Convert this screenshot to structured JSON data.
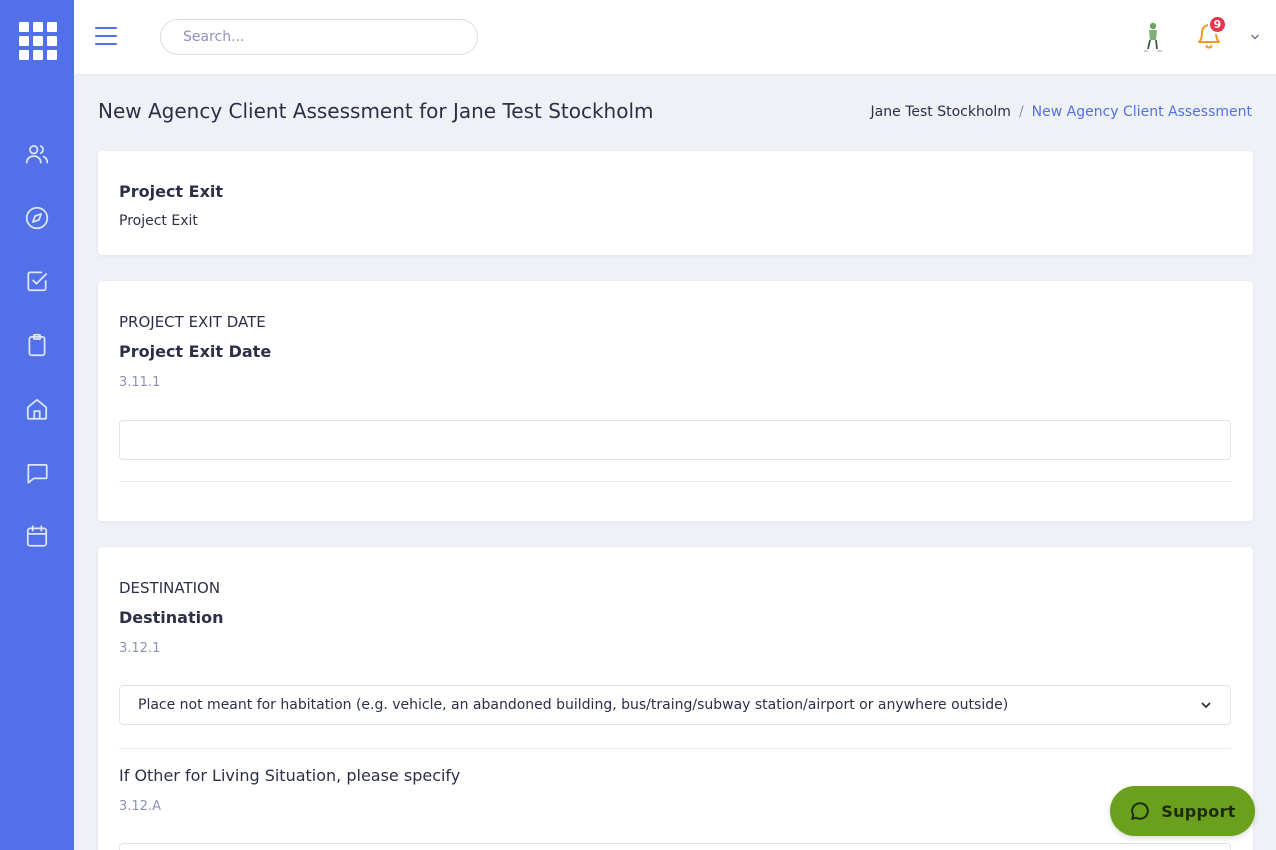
{
  "colors": {
    "primary": "#5271e8",
    "badge": "#e8344a",
    "support": "#6aa01b"
  },
  "topbar": {
    "search_placeholder": "Search...",
    "notification_count": "9"
  },
  "sidebar": {
    "items": [
      {
        "icon": "users-icon"
      },
      {
        "icon": "compass-icon"
      },
      {
        "icon": "checkbox-icon"
      },
      {
        "icon": "clipboard-icon"
      },
      {
        "icon": "home-icon"
      },
      {
        "icon": "message-icon"
      },
      {
        "icon": "calendar-icon"
      }
    ]
  },
  "header": {
    "title": "New Agency Client Assessment for Jane Test Stockholm",
    "breadcrumb": {
      "home": "Jane Test Stockholm",
      "separator": "/",
      "current": "New Agency Client Assessment"
    }
  },
  "project_exit": {
    "heading": "Project Exit",
    "text": "Project Exit"
  },
  "exit_date": {
    "section": "PROJECT EXIT DATE",
    "label": "Project Exit Date",
    "code": "3.11.1",
    "value": ""
  },
  "destination": {
    "section": "DESTINATION",
    "label": "Destination",
    "code": "3.12.1",
    "selected": "Place not meant for habitation (e.g. vehicle, an abandoned building, bus/traing/subway station/airport or anywhere outside)",
    "other_label": "If Other for Living Situation, please specify",
    "other_code": "3.12.A"
  },
  "support": {
    "label": "Support"
  }
}
